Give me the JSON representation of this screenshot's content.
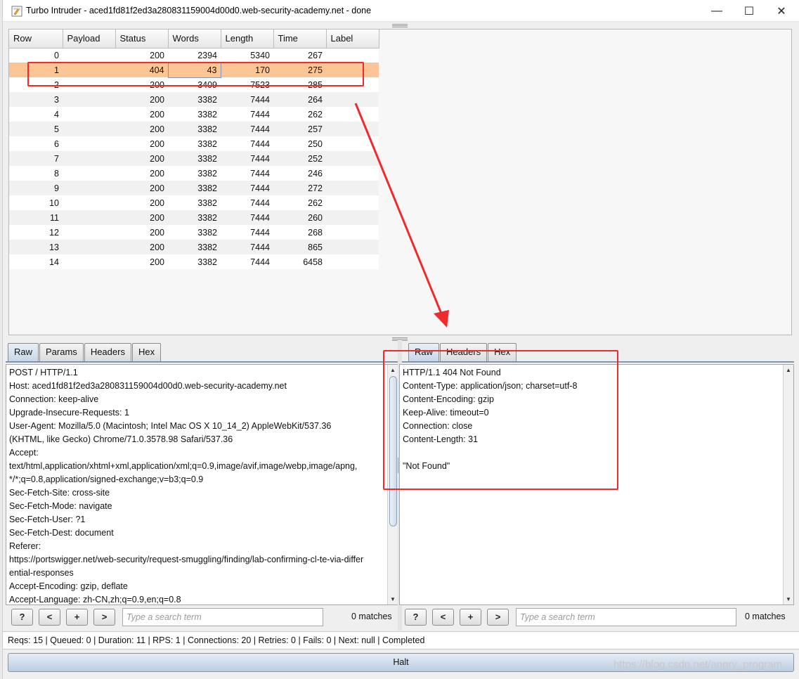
{
  "window": {
    "title": "Turbo Intruder - aced1fd81f2ed3a280831159004d00d0.web-security-academy.net - done",
    "minimize": "—",
    "maximize": "☐",
    "close": "✕"
  },
  "results": {
    "columns": [
      "Row",
      "Payload",
      "Status",
      "Words",
      "Length",
      "Time",
      "Label"
    ],
    "selected_row": "1",
    "rows": [
      {
        "row": "0",
        "payload": "",
        "status": "200",
        "words": "2394",
        "length": "5340",
        "time": "267",
        "label": ""
      },
      {
        "row": "1",
        "payload": "",
        "status": "404",
        "words": "43",
        "length": "170",
        "time": "275",
        "label": ""
      },
      {
        "row": "2",
        "payload": "",
        "status": "200",
        "words": "3409",
        "length": "7523",
        "time": "285",
        "label": ""
      },
      {
        "row": "3",
        "payload": "",
        "status": "200",
        "words": "3382",
        "length": "7444",
        "time": "264",
        "label": ""
      },
      {
        "row": "4",
        "payload": "",
        "status": "200",
        "words": "3382",
        "length": "7444",
        "time": "262",
        "label": ""
      },
      {
        "row": "5",
        "payload": "",
        "status": "200",
        "words": "3382",
        "length": "7444",
        "time": "257",
        "label": ""
      },
      {
        "row": "6",
        "payload": "",
        "status": "200",
        "words": "3382",
        "length": "7444",
        "time": "250",
        "label": ""
      },
      {
        "row": "7",
        "payload": "",
        "status": "200",
        "words": "3382",
        "length": "7444",
        "time": "252",
        "label": ""
      },
      {
        "row": "8",
        "payload": "",
        "status": "200",
        "words": "3382",
        "length": "7444",
        "time": "246",
        "label": ""
      },
      {
        "row": "9",
        "payload": "",
        "status": "200",
        "words": "3382",
        "length": "7444",
        "time": "272",
        "label": ""
      },
      {
        "row": "10",
        "payload": "",
        "status": "200",
        "words": "3382",
        "length": "7444",
        "time": "262",
        "label": ""
      },
      {
        "row": "11",
        "payload": "",
        "status": "200",
        "words": "3382",
        "length": "7444",
        "time": "260",
        "label": ""
      },
      {
        "row": "12",
        "payload": "",
        "status": "200",
        "words": "3382",
        "length": "7444",
        "time": "268",
        "label": ""
      },
      {
        "row": "13",
        "payload": "",
        "status": "200",
        "words": "3382",
        "length": "7444",
        "time": "865",
        "label": ""
      },
      {
        "row": "14",
        "payload": "",
        "status": "200",
        "words": "3382",
        "length": "7444",
        "time": "6458",
        "label": ""
      }
    ]
  },
  "request": {
    "tabs": [
      "Raw",
      "Params",
      "Headers",
      "Hex"
    ],
    "active_tab": "Raw",
    "lines": [
      "POST / HTTP/1.1",
      "Host: aced1fd81f2ed3a280831159004d00d0.web-security-academy.net",
      "Connection: keep-alive",
      "Upgrade-Insecure-Requests: 1",
      "User-Agent: Mozilla/5.0 (Macintosh; Intel Mac OS X 10_14_2) AppleWebKit/537.36",
      "(KHTML, like Gecko) Chrome/71.0.3578.98 Safari/537.36",
      "Accept:",
      "text/html,application/xhtml+xml,application/xml;q=0.9,image/avif,image/webp,image/apng,",
      "*/*;q=0.8,application/signed-exchange;v=b3;q=0.9",
      "Sec-Fetch-Site: cross-site",
      "Sec-Fetch-Mode: navigate",
      "Sec-Fetch-User: ?1",
      "Sec-Fetch-Dest: document",
      "Referer:",
      "https://portswigger.net/web-security/request-smuggling/finding/lab-confirming-cl-te-via-differ",
      "ential-responses",
      "Accept-Encoding: gzip, deflate",
      "Accept-Language: zh-CN,zh;q=0.9,en;q=0.8"
    ],
    "search": {
      "help": "?",
      "prev": "<",
      "add": "+",
      "next": ">",
      "placeholder": "Type a search term",
      "matches": "0 matches"
    }
  },
  "response": {
    "tabs": [
      "Raw",
      "Headers",
      "Hex"
    ],
    "active_tab": "Raw",
    "lines": [
      "HTTP/1.1 404 Not Found",
      "Content-Type: application/json; charset=utf-8",
      "Content-Encoding: gzip",
      "Keep-Alive: timeout=0",
      "Connection: close",
      "Content-Length: 31",
      "",
      "\"Not Found\""
    ],
    "search": {
      "help": "?",
      "prev": "<",
      "add": "+",
      "next": ">",
      "placeholder": "Type a search term",
      "matches": "0 matches"
    }
  },
  "status_bar": "Reqs: 15 | Queued: 0 | Duration: 11 | RPS: 1 | Connections: 20 | Retries: 0 | Fails: 0 | Next: null | Completed",
  "halt_button": "Halt",
  "watermark": "https://blog.csdn.net/angry_program",
  "colors": {
    "selected_row": "#fdc596",
    "annotation": "#ef2b2b",
    "tab_active": "#c7d6e8"
  }
}
